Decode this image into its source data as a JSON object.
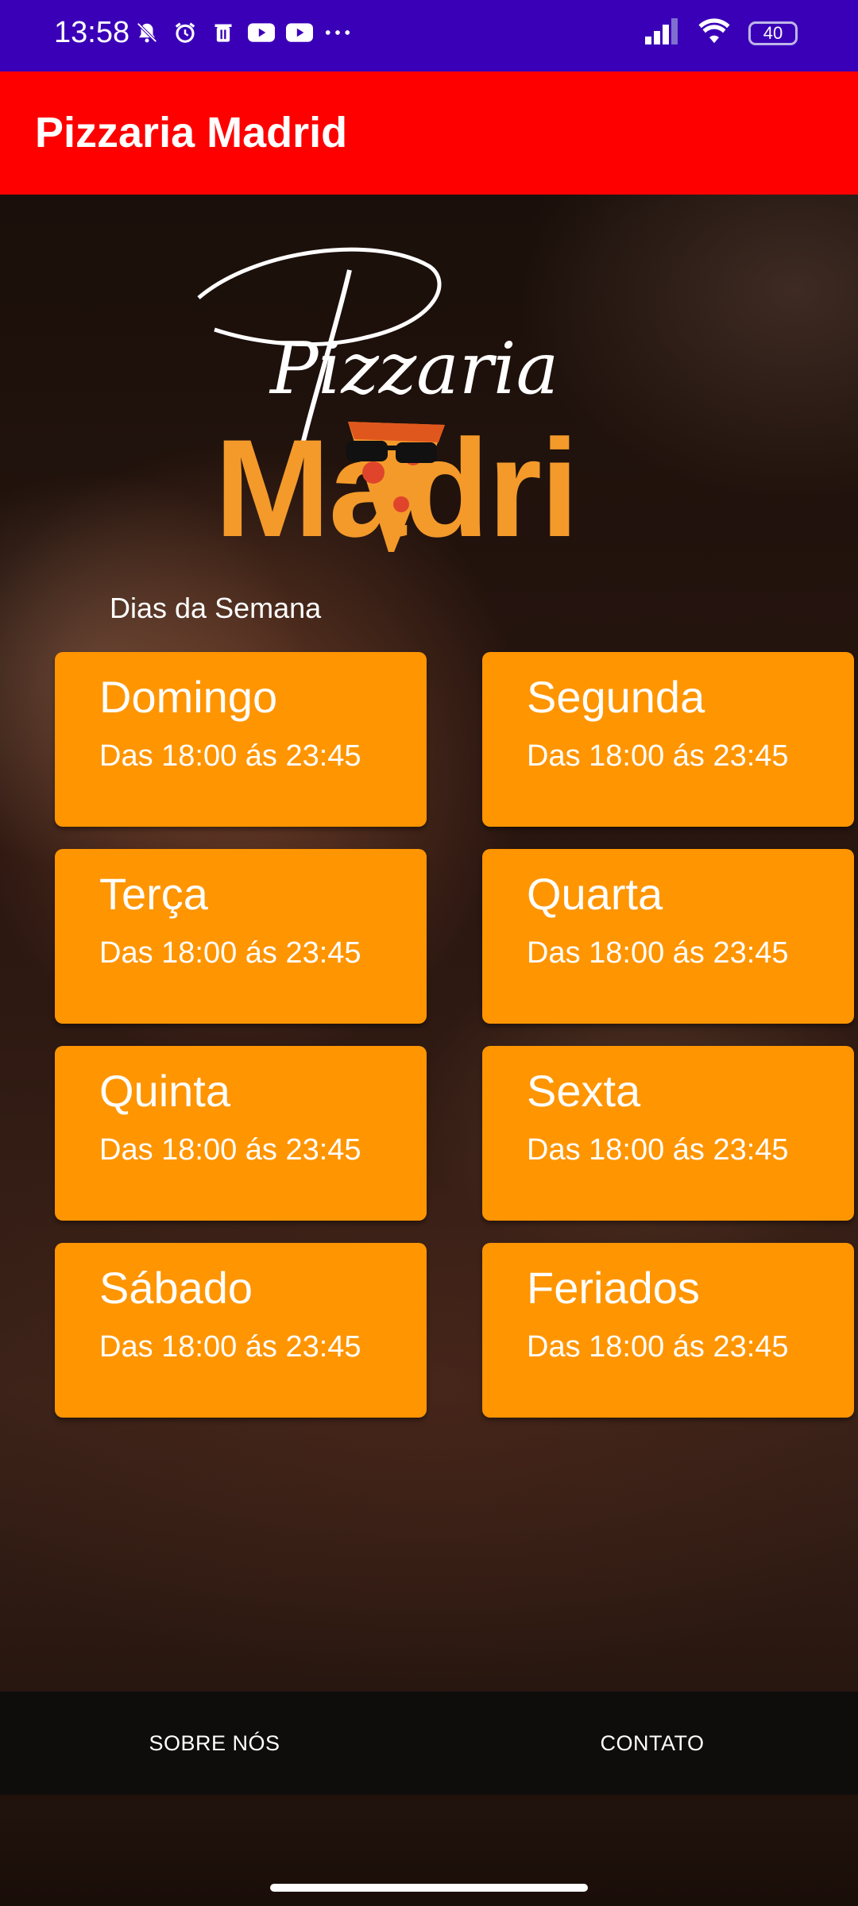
{
  "status_bar": {
    "time": "13:58",
    "battery": "40",
    "icons": [
      "bell-off-icon",
      "alarm-icon",
      "trash-icon",
      "youtube-icon",
      "youtube-icon",
      "more-icon",
      "signal-icon",
      "wifi-icon",
      "battery-icon"
    ]
  },
  "app_bar": {
    "title": "Pizzaria Madrid"
  },
  "logo": {
    "script_text": "Pizzaria",
    "brand_text": "Madri"
  },
  "schedule": {
    "section_label": "Dias da Semana",
    "days": [
      {
        "name": "Domingo",
        "hours": "Das 18:00 ás 23:45"
      },
      {
        "name": "Segunda",
        "hours": "Das 18:00 ás 23:45"
      },
      {
        "name": "Terça",
        "hours": "Das 18:00 ás 23:45"
      },
      {
        "name": "Quarta",
        "hours": "Das 18:00 ás 23:45"
      },
      {
        "name": "Quinta",
        "hours": "Das 18:00 ás 23:45"
      },
      {
        "name": "Sexta",
        "hours": "Das 18:00 ás 23:45"
      },
      {
        "name": "Sábado",
        "hours": "Das 18:00 ás 23:45"
      },
      {
        "name": "Feriados",
        "hours": "Das 18:00 ás 23:45"
      }
    ]
  },
  "bottom_nav": {
    "about": "SOBRE NÓS",
    "contact": "CONTATO"
  },
  "colors": {
    "status_bar": "#3a00b8",
    "app_bar": "#ff0000",
    "card": "#ff9500",
    "logo_orange": "#f39a2b"
  }
}
